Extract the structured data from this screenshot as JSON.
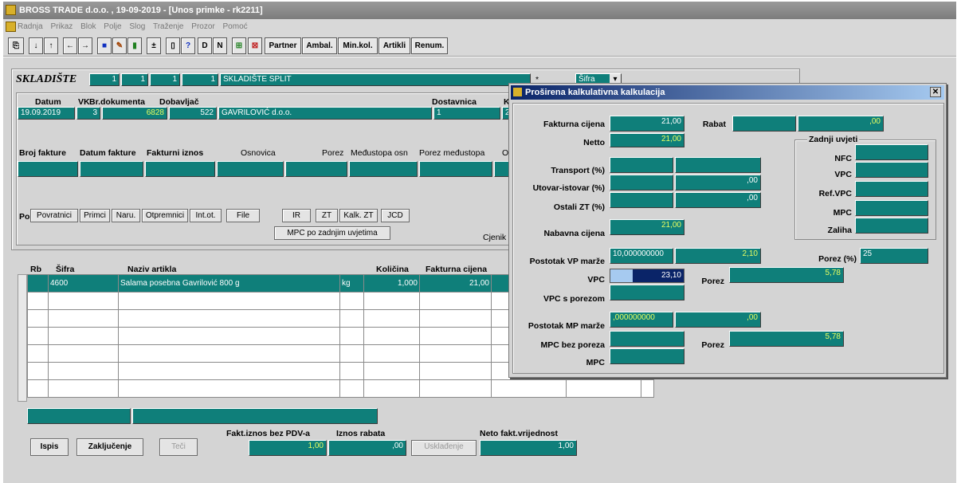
{
  "window": {
    "title": "BROSS TRADE d.o.o. , 19-09-2019 - [Unos primke  - rk2211]"
  },
  "menu": [
    "Radnja",
    "Prikaz",
    "Blok",
    "Polje",
    "Slog",
    "Traženje",
    "Prozor",
    "Pomoć"
  ],
  "toolbar": {
    "d": "D",
    "n": "N",
    "partner": "Partner",
    "ambal": "Ambal.",
    "minkol": "Min.kol.",
    "artikli": "Artikli",
    "renum": "Renum."
  },
  "skladiste": {
    "label": "SKLADIŠTE",
    "f1": "1",
    "f2": "1",
    "f3": "1",
    "f4": "1",
    "name": "SKLADIŠTE SPLIT",
    "star": "*",
    "sifra": "Šifra"
  },
  "doc": {
    "h_datum": "Datum",
    "h_vk": "VK",
    "h_brdok": "Br.dokumenta",
    "h_dobavljac": "Dobavljač",
    "h_dostavnica": "Dostavnica",
    "h_k": "K",
    "datum": "19.09.2019",
    "vk": "3",
    "brdok": "6828",
    "dob_sifra": "522",
    "dob_naziv": "GAVRILOVIĆ d.o.o.",
    "dostavnica": "1",
    "k": "2"
  },
  "faktura": {
    "h1": "Broj fakture",
    "h2": "Datum fakture",
    "h3": "Fakturni iznos",
    "h4": "Osnovica",
    "h5": "Porez",
    "h6": "Međustopa osn",
    "h7": "Porez međustopa",
    "h8": "O"
  },
  "po": {
    "label": "Po",
    "povratnici": "Povratnici",
    "primci": "Primci",
    "naru": "Naru.",
    "otpremnici": "Otpremnici",
    "intot": "Int.ot.",
    "file": "File",
    "ir": "IR",
    "zt": "ZT",
    "kalkzt": "Kalk. ZT",
    "jcd": "JCD",
    "mpc": "MPC po zadnjim uvjetima",
    "cjenik": "Cjenik"
  },
  "items": {
    "h_rb": "Rb",
    "h_sifra": "Šifra",
    "h_naziv": "Naziv artikla",
    "h_kolicina": "Količina",
    "h_fc": "Fakturna cijena",
    "row1": {
      "sifra": "4600",
      "naziv": "Salama posebna Gavrilović 800 g",
      "jm": "kg",
      "kolicina": "1,000",
      "fc": "21,00"
    }
  },
  "bottom": {
    "ispis": "Ispis",
    "zakljucenje": "Zaključenje",
    "teci": "Teči",
    "usklad": "Usklađenje",
    "h_fakt": "Fakt.iznos bez PDV-a",
    "fakt": "1,00",
    "h_rabat": "Iznos rabata",
    "rabat": ",00",
    "h_neto": "Neto fakt.vrijednost",
    "neto": "1,00"
  },
  "dialog": {
    "title": "Proširena kalkulativna kalkulacija",
    "close": "✕",
    "fakturna_cijena_l": "Fakturna cijena",
    "fakturna_cijena": "21,00",
    "rabat_l": "Rabat",
    "rabat": ",00",
    "netto_l": "Netto",
    "netto": "21,00",
    "transport_l": "Transport (%)",
    "utovar_l": "Utovar-istovar (%)",
    "utovar": ",00",
    "ostali_l": "Ostali ZT (%)",
    "ostali": ",00",
    "nabavna_l": "Nabavna cijena",
    "nabavna": "21,00",
    "vp_marza_l": "Postotak VP marže",
    "vp_marza_pct": "10,000000000",
    "vp_marza": "2,10",
    "porez_pct_l": "Porez (%)",
    "porez_pct": "25",
    "vpc_l": "VPC",
    "vpc": "23,10",
    "porez_l": "Porez",
    "vpc_porez": "5,78",
    "vpc_s_porezom_l": "VPC s porezom",
    "mp_marza_l": "Postotak MP marže",
    "mp_marza_pct": ",000000000",
    "mp_marza": ",00",
    "mpc_bez_l": "MPC bez poreza",
    "porez2_l": "Porez",
    "mpc_porez": "5,78",
    "mpc_l": "MPC",
    "zadnji": {
      "title": "Zadnji uvjeti",
      "nfc": "NFC",
      "vpc": "VPC",
      "refvpc": "Ref.VPC",
      "mpc": "MPC",
      "zaliha": "Zaliha"
    }
  }
}
